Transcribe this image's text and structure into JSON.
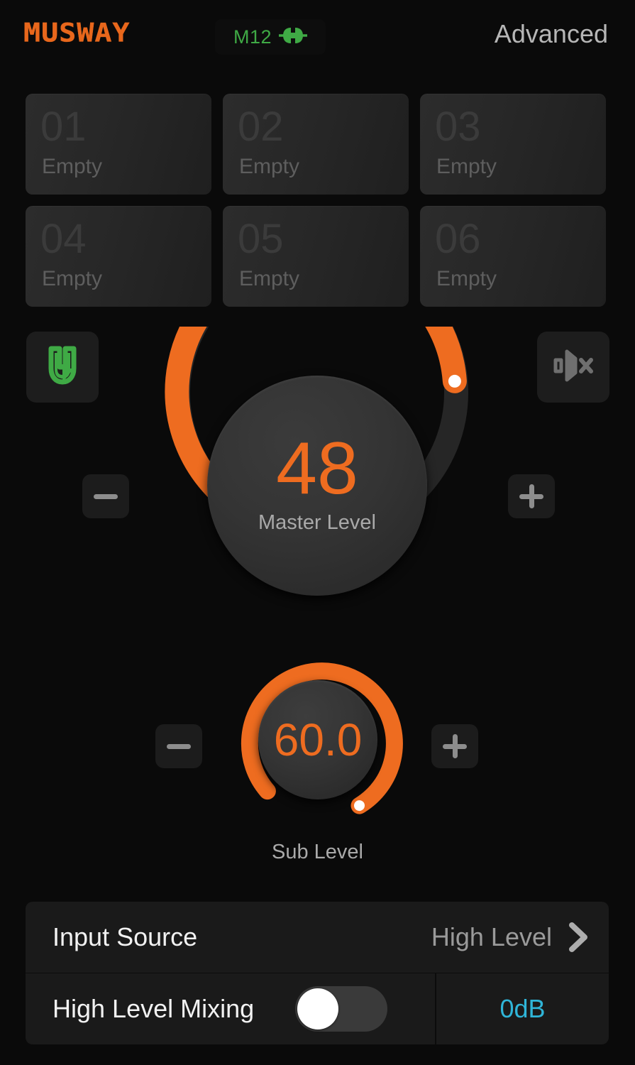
{
  "header": {
    "brand": "MUSWAY",
    "model": "M12",
    "connection_icon": "plug-connected-icon",
    "connection_color": "#3faa45",
    "advanced_label": "Advanced"
  },
  "presets": [
    {
      "number": "01",
      "state": "Empty"
    },
    {
      "number": "02",
      "state": "Empty"
    },
    {
      "number": "03",
      "state": "Empty"
    },
    {
      "number": "04",
      "state": "Empty"
    },
    {
      "number": "05",
      "state": "Empty"
    },
    {
      "number": "06",
      "state": "Empty"
    }
  ],
  "master": {
    "value": "48",
    "label": "Master Level",
    "decrement_label": "-",
    "increment_label": "+",
    "energy_icon": "energy-bolt-icon",
    "mute_icon": "speaker-mute-icon",
    "arc_start_deg": 135,
    "arc_sweep_deg": 270,
    "arc_filled_deg": 202,
    "accent_color": "#ee6c20",
    "track_color": "#262626"
  },
  "sub": {
    "value": "60.0",
    "label": "Sub Level",
    "decrement_label": "-",
    "increment_label": "+",
    "arc_start_deg": 135,
    "arc_sweep_deg": 270,
    "arc_filled_deg": 258,
    "accent_color": "#ee6c20"
  },
  "rows": {
    "input_source": {
      "title": "Input Source",
      "value": "High Level",
      "chevron_icon": "chevron-right-icon"
    },
    "high_level_mixing": {
      "title": "High Level Mixing",
      "toggle_state": "off",
      "db_value": "0dB",
      "db_color": "#2fb5d8"
    }
  }
}
